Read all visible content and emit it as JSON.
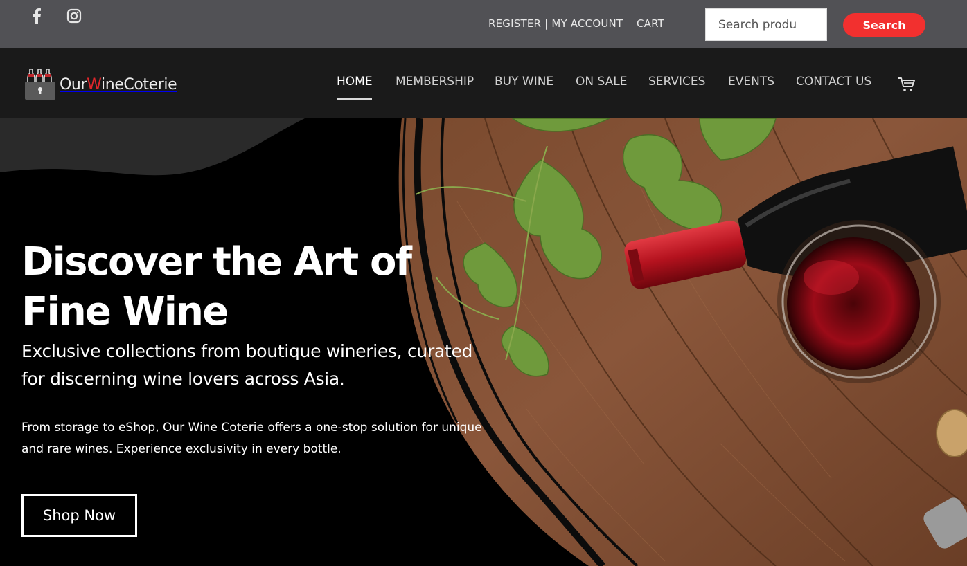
{
  "topbar": {
    "social": [
      {
        "icon": "facebook-icon"
      },
      {
        "icon": "instagram-icon"
      }
    ],
    "account_link": "REGISTER | MY ACCOUNT",
    "cart_link": "CART",
    "search": {
      "placeholder": "Search produ",
      "button_label": "Search"
    }
  },
  "navbar": {
    "logo": {
      "prefix": "Our",
      "accent": "W",
      "suffix": "ineCoterie"
    },
    "items": [
      {
        "label": "HOME",
        "active": true
      },
      {
        "label": "MEMBERSHIP"
      },
      {
        "label": "BUY WINE"
      },
      {
        "label": "ON SALE"
      },
      {
        "label": "SERVICES"
      },
      {
        "label": "EVENTS"
      },
      {
        "label": "CONTACT US"
      }
    ],
    "cart_icon": "cart-icon"
  },
  "hero": {
    "title": "Discover the Art of Fine Wine",
    "subtitle": "Exclusive collections from boutique wineries, curated for discerning wine lovers across Asia.",
    "description": "From storage to eShop, Our Wine Coterie offers a one-stop solution for unique and rare wines. Experience exclusivity in every bottle.",
    "cta_label": "Shop Now"
  },
  "colors": {
    "topbar_bg": "#515155",
    "nav_bg": "#1a1a1a",
    "accent_red": "#f2302f",
    "hero_bg": "#000000"
  }
}
